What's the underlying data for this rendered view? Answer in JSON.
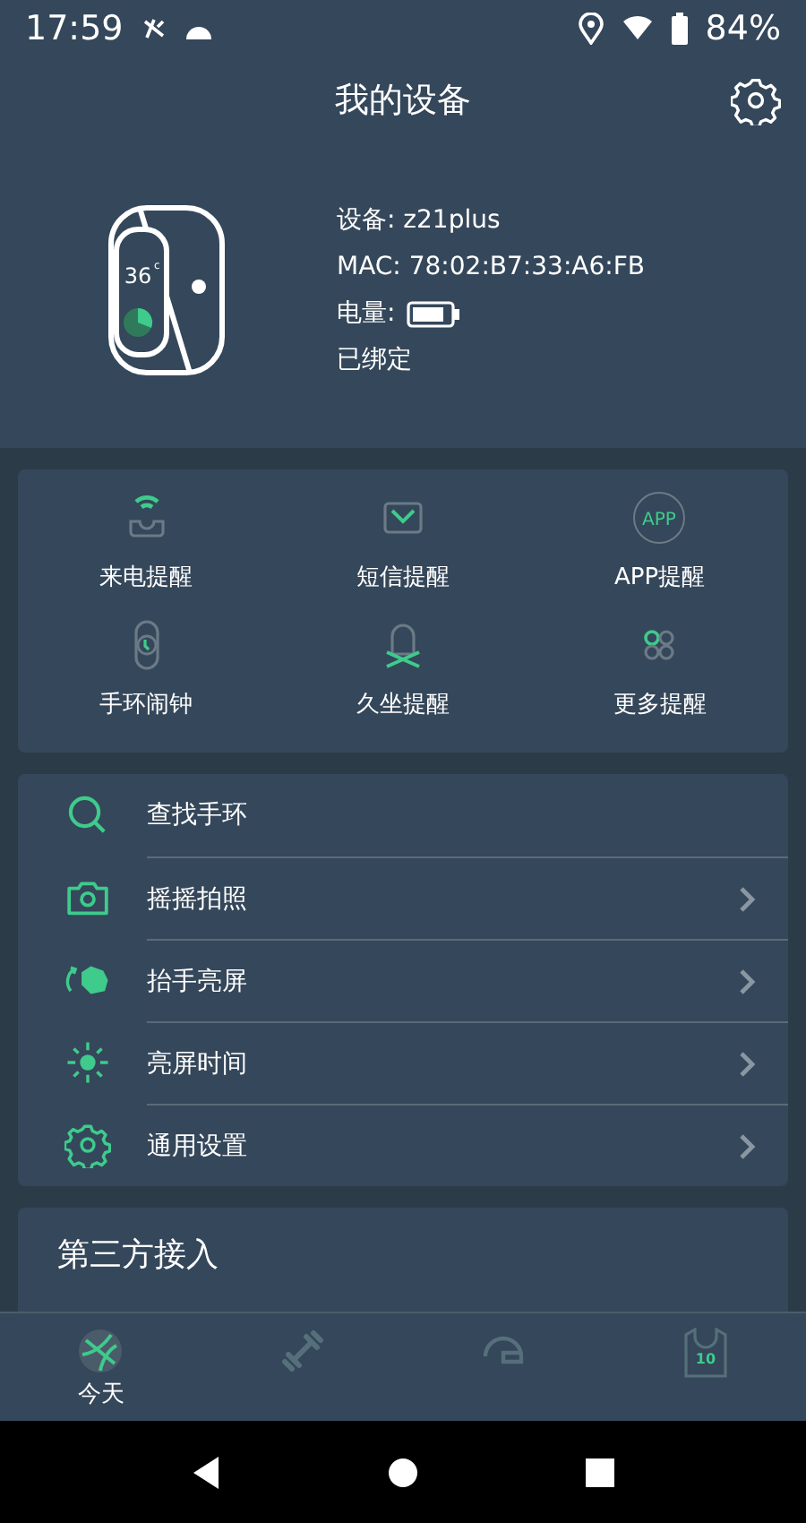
{
  "status_bar": {
    "time": "17:59",
    "battery": "84%"
  },
  "header": {
    "title": "我的设备"
  },
  "device": {
    "name": "设备: z21plus",
    "mac": "MAC: 78:02:B7:33:A6:FB",
    "battery_label": "电量:",
    "bound": "已绑定",
    "temperature": "36",
    "temp_unit": "c"
  },
  "reminders": [
    {
      "kind": "call",
      "label": "来电提醒"
    },
    {
      "kind": "sms",
      "label": "短信提醒"
    },
    {
      "kind": "app",
      "label": "APP提醒",
      "icon_text": "APP"
    },
    {
      "kind": "alarm",
      "label": "手环闹钟"
    },
    {
      "kind": "sedentary",
      "label": "久坐提醒"
    },
    {
      "kind": "more",
      "label": "更多提醒"
    }
  ],
  "menu": [
    {
      "kind": "search",
      "label": "查找手环",
      "arrow": false
    },
    {
      "kind": "camera",
      "label": "摇摇拍照",
      "arrow": true
    },
    {
      "kind": "raise",
      "label": "抬手亮屏",
      "arrow": true
    },
    {
      "kind": "brightness",
      "label": "亮屏时间",
      "arrow": true
    },
    {
      "kind": "settings",
      "label": "通用设置",
      "arrow": true
    }
  ],
  "third_party": {
    "title": "第三方接入"
  },
  "bottom_nav": [
    {
      "kind": "today",
      "label": "今天",
      "selected": true
    },
    {
      "kind": "sport",
      "selected": false
    },
    {
      "kind": "helmet",
      "selected": false
    },
    {
      "kind": "jersey",
      "selected": false,
      "number": "10"
    }
  ]
}
